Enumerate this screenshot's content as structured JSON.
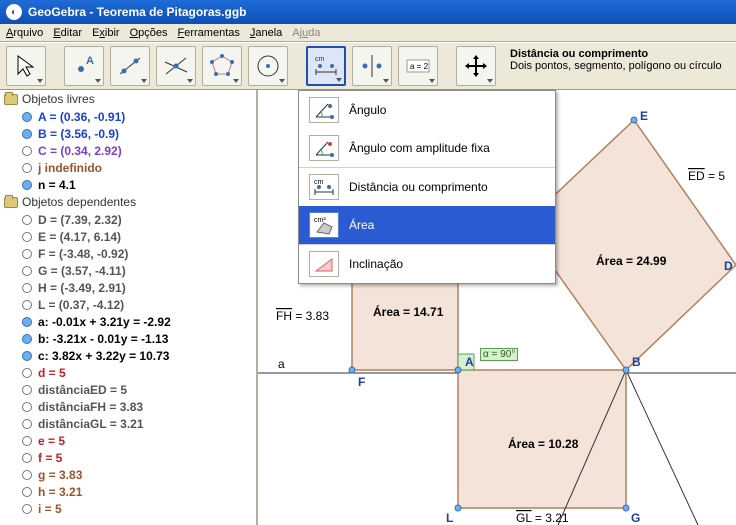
{
  "window": {
    "title": "GeoGebra - Teorema de Pitagoras.ggb"
  },
  "menu": {
    "arquivo": "Arquivo",
    "editar": "Editar",
    "exibir": "Exibir",
    "opcoes": "Opções",
    "ferramentas": "Ferramentas",
    "janela": "Janela",
    "ajuda": "Ajuda"
  },
  "toolbar": {
    "desc_title": "Distância ou comprimento",
    "desc_sub": "Dois pontos, segmento, polígono ou círculo",
    "btn_label": "a = 2"
  },
  "dropdown": {
    "angulo": "Ângulo",
    "angulo_fixo": "Ângulo com amplitude fixa",
    "distancia": "Distância ou comprimento",
    "area": "Área",
    "inclinacao": "Inclinação"
  },
  "sidebar": {
    "free_header": "Objetos livres",
    "dep_header": "Objetos dependentes",
    "free": [
      {
        "cls": "c-blue",
        "filled": true,
        "txt": "A = (0.36, -0.91)"
      },
      {
        "cls": "c-blue",
        "filled": true,
        "txt": "B = (3.56, -0.9)"
      },
      {
        "cls": "c-purple",
        "filled": false,
        "txt": "C = (0.34, 2.92)"
      },
      {
        "cls": "c-brown",
        "filled": false,
        "txt": "j indefinido"
      },
      {
        "cls": "c-black",
        "filled": true,
        "txt": "n = 4.1"
      }
    ],
    "dep": [
      {
        "cls": "c-gray",
        "filled": false,
        "txt": "D = (7.39, 2.32)"
      },
      {
        "cls": "c-gray",
        "filled": false,
        "txt": "E = (4.17, 6.14)"
      },
      {
        "cls": "c-gray",
        "filled": false,
        "txt": "F = (-3.48, -0.92)"
      },
      {
        "cls": "c-gray",
        "filled": false,
        "txt": "G = (3.57, -4.11)"
      },
      {
        "cls": "c-gray",
        "filled": false,
        "txt": "H = (-3.49, 2.91)"
      },
      {
        "cls": "c-gray",
        "filled": false,
        "txt": "L = (0.37, -4.12)"
      },
      {
        "cls": "c-black",
        "filled": true,
        "txt": "a: -0.01x + 3.21y = -2.92"
      },
      {
        "cls": "c-black",
        "filled": true,
        "txt": "b: -3.21x - 0.01y = -1.13"
      },
      {
        "cls": "c-black",
        "filled": true,
        "txt": "c: 3.82x + 3.22y = 10.73"
      },
      {
        "cls": "c-red",
        "filled": false,
        "txt": "d = 5"
      },
      {
        "cls": "c-gray",
        "filled": false,
        "txt": "distânciaED = 5"
      },
      {
        "cls": "c-gray",
        "filled": false,
        "txt": "distânciaFH = 3.83"
      },
      {
        "cls": "c-gray",
        "filled": false,
        "txt": "distânciaGL = 3.21"
      },
      {
        "cls": "c-red",
        "filled": false,
        "txt": "e = 5"
      },
      {
        "cls": "c-red",
        "filled": false,
        "txt": "f = 5"
      },
      {
        "cls": "c-brown",
        "filled": false,
        "txt": "g = 3.83"
      },
      {
        "cls": "c-brown",
        "filled": false,
        "txt": "h = 3.21"
      },
      {
        "cls": "c-brown",
        "filled": false,
        "txt": "i = 5"
      }
    ]
  },
  "canvas": {
    "areas": {
      "a1": "Área = 14.71",
      "a2": "Área = 24.99",
      "a3": "Área = 10.28"
    },
    "labels": {
      "FH": "FH",
      "FHval": " = 3.83",
      "ED": "ED",
      "EDval": " = 5",
      "GL": "GL",
      "GLval": " = 3.21",
      "alpha": "α = 90°",
      "a_axis": "a",
      "A": "A",
      "B": "B",
      "E": "E",
      "D": "D",
      "F": "F",
      "G": "G",
      "L": "L"
    }
  }
}
